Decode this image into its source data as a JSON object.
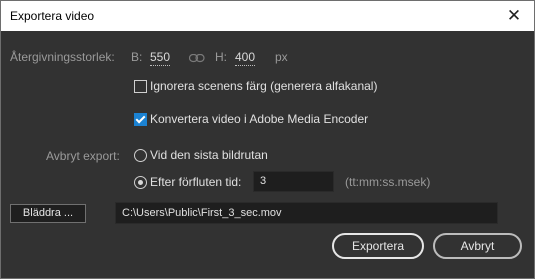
{
  "window": {
    "title": "Exportera video"
  },
  "size": {
    "label": "Återgivningsstorlek:",
    "width_label": "B:",
    "width_value": "550",
    "height_label": "H:",
    "height_value": "400",
    "unit": "px",
    "link_icon": "chain-link-icon"
  },
  "options": {
    "ignore_stage_color": {
      "label": "Ignorera scenens färg (generera alfakanal)",
      "checked": false
    },
    "convert_ame": {
      "label": "Konvertera video i Adobe Media Encoder",
      "checked": true
    }
  },
  "stop_export": {
    "label": "Avbryt export:",
    "last_frame": {
      "label": "Vid den sista bildrutan",
      "selected": false
    },
    "after_time": {
      "label": "Efter förfluten tid:",
      "selected": true,
      "value": "3",
      "format_hint": "(tt:mm:ss.msek)"
    }
  },
  "browse": {
    "button_label": "Bläddra ...",
    "path": "C:\\Users\\Public\\First_3_sec.mov"
  },
  "actions": {
    "export_label": "Exportera",
    "cancel_label": "Avbryt"
  },
  "colors": {
    "dialog_bg": "#323232",
    "checkbox_accent": "#1b82d2",
    "titlebar_bg": "#ffffff"
  }
}
